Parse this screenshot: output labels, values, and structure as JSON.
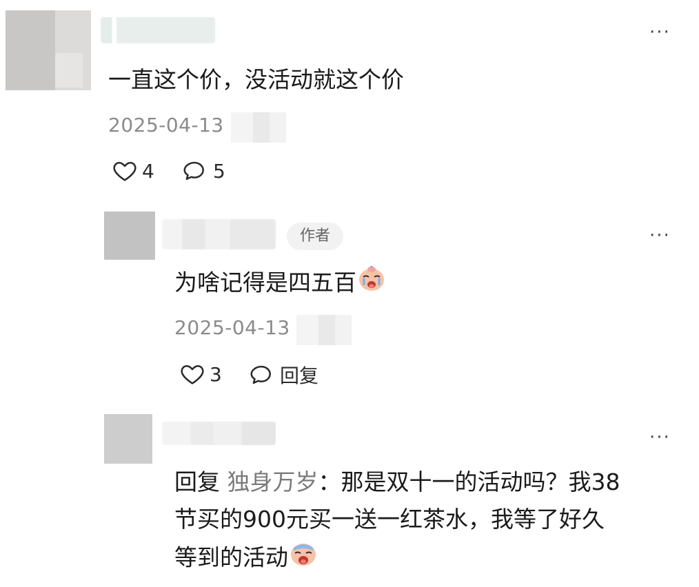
{
  "comments": [
    {
      "content": "一直这个价，没活动就这个价",
      "time": "2025-04-13",
      "likes": "4",
      "replies": "5",
      "more": "···"
    },
    {
      "author_tag": "作者",
      "content": "为啥记得是四五百",
      "emoji": "crying-face",
      "time": "2025-04-13",
      "likes": "3",
      "reply_label": "回复",
      "more": "···"
    },
    {
      "reply_prefix": "回复",
      "mention": "独身万岁",
      "colon": "：",
      "lines": [
        "那是双十一的活动吗？我38",
        "节买的900元买一送一红茶水，我等了好久",
        "等到的活动"
      ],
      "emoji": "crying-face",
      "more": "···"
    }
  ]
}
